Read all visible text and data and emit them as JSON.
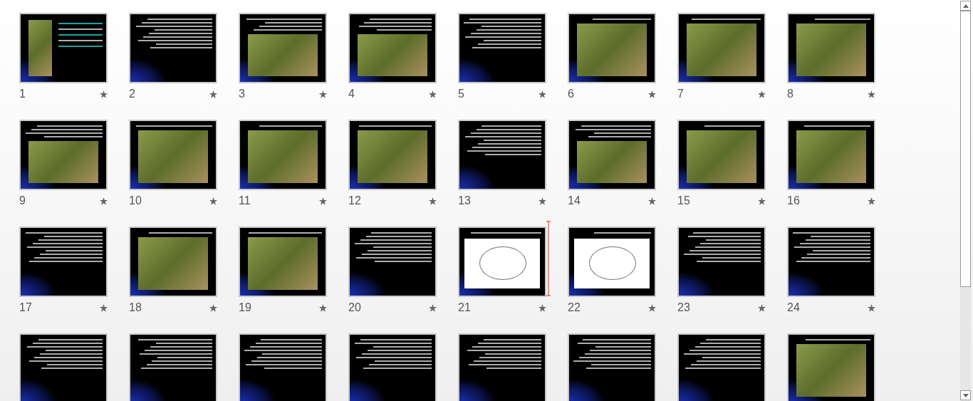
{
  "slides": [
    {
      "number": "1",
      "kind": "photo-text",
      "has_animation": true,
      "drop_marker_after": false
    },
    {
      "number": "2",
      "kind": "text",
      "has_animation": true,
      "drop_marker_after": false
    },
    {
      "number": "3",
      "kind": "text-photo",
      "has_animation": true,
      "drop_marker_after": false
    },
    {
      "number": "4",
      "kind": "text-photo",
      "has_animation": true,
      "drop_marker_after": false
    },
    {
      "number": "5",
      "kind": "text",
      "has_animation": true,
      "drop_marker_after": false
    },
    {
      "number": "6",
      "kind": "photo",
      "has_animation": true,
      "drop_marker_after": false
    },
    {
      "number": "7",
      "kind": "photo",
      "has_animation": true,
      "drop_marker_after": false
    },
    {
      "number": "8",
      "kind": "photo",
      "has_animation": true,
      "drop_marker_after": false
    },
    {
      "number": "9",
      "kind": "text-photo",
      "has_animation": true,
      "drop_marker_after": false
    },
    {
      "number": "10",
      "kind": "photo",
      "has_animation": true,
      "drop_marker_after": false
    },
    {
      "number": "11",
      "kind": "photo",
      "has_animation": true,
      "drop_marker_after": false
    },
    {
      "number": "12",
      "kind": "photo",
      "has_animation": true,
      "drop_marker_after": false
    },
    {
      "number": "13",
      "kind": "text",
      "has_animation": true,
      "drop_marker_after": false
    },
    {
      "number": "14",
      "kind": "text-photo",
      "has_animation": true,
      "drop_marker_after": false
    },
    {
      "number": "15",
      "kind": "photo",
      "has_animation": true,
      "drop_marker_after": false
    },
    {
      "number": "16",
      "kind": "photo",
      "has_animation": true,
      "drop_marker_after": false
    },
    {
      "number": "17",
      "kind": "text",
      "has_animation": true,
      "drop_marker_after": false
    },
    {
      "number": "18",
      "kind": "photo",
      "has_animation": true,
      "drop_marker_after": false
    },
    {
      "number": "19",
      "kind": "photo",
      "has_animation": true,
      "drop_marker_after": false
    },
    {
      "number": "20",
      "kind": "text",
      "has_animation": true,
      "drop_marker_after": false
    },
    {
      "number": "21",
      "kind": "diagram",
      "has_animation": true,
      "drop_marker_after": true
    },
    {
      "number": "22",
      "kind": "diagram",
      "has_animation": true,
      "drop_marker_after": false
    },
    {
      "number": "23",
      "kind": "text",
      "has_animation": true,
      "drop_marker_after": false
    },
    {
      "number": "24",
      "kind": "text",
      "has_animation": true,
      "drop_marker_after": false
    },
    {
      "kind": "text"
    },
    {
      "kind": "text"
    },
    {
      "kind": "text"
    },
    {
      "kind": "text"
    },
    {
      "kind": "text"
    },
    {
      "kind": "text"
    },
    {
      "kind": "text"
    },
    {
      "kind": "photo"
    }
  ]
}
